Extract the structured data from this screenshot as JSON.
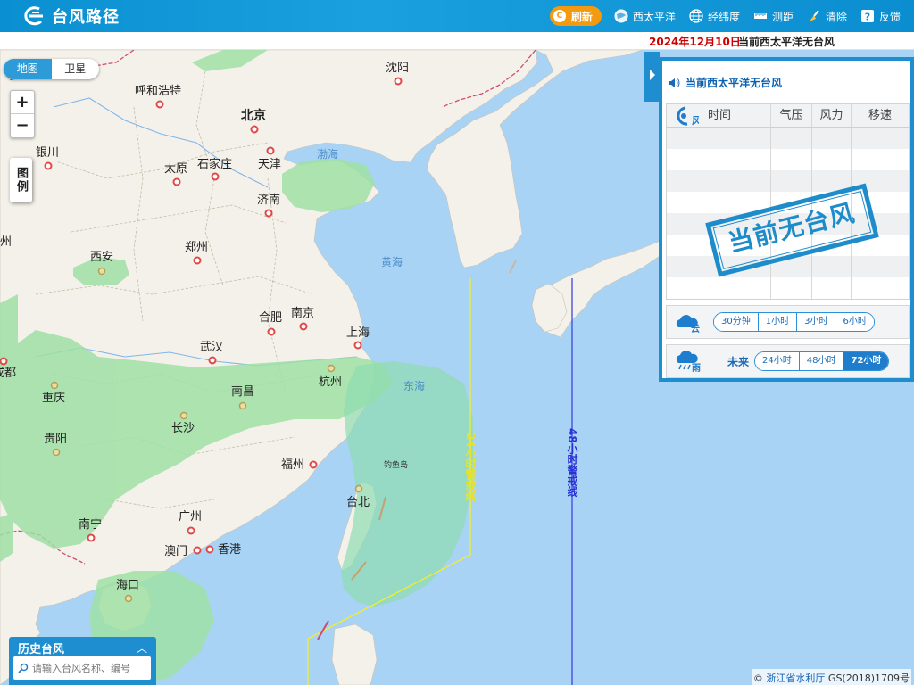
{
  "header": {
    "app_title": "台风路径",
    "tools": {
      "refresh": "刷新",
      "west_pacific": "西太平洋",
      "lat_lon": "经纬度",
      "measure": "测距",
      "clear": "清除",
      "feedback": "反馈"
    },
    "icons": {
      "refresh": "refresh-icon",
      "west_pacific": "globe-icon",
      "lat_lon": "grid-globe-icon",
      "measure": "ruler-icon",
      "clear": "broom-icon",
      "feedback": "help-icon"
    }
  },
  "datebar": {
    "date": "2024年12月10日",
    "message": "当前西太平洋无台风"
  },
  "map": {
    "toggle": {
      "map": "地图",
      "satellite": "卫星",
      "active": "map"
    },
    "zoom_in": "+",
    "zoom_out": "−",
    "legend": "图例",
    "cities": {
      "shenyang": "沈阳",
      "hohhot": "呼和浩特",
      "beijing": "北京",
      "yinchuan": "银川",
      "taiyuan": "太原",
      "shijiazhuang": "石家庄",
      "tianjin": "天津",
      "jinan": "济南",
      "zhengzhou": "郑州",
      "xian": "西安",
      "hefei": "合肥",
      "nanjing": "南京",
      "shanghai": "上海",
      "wuhan": "武汉",
      "hangzhou": "杭州",
      "chengdu": "成都",
      "chongqing": "重庆",
      "nanchang": "南昌",
      "changsha": "长沙",
      "guiyang": "贵阳",
      "fuzhou": "福州",
      "taipei": "台北",
      "nanning": "南宁",
      "guangzhou": "广州",
      "macau": "澳门",
      "hongkong": "香港",
      "haikou": "海口",
      "xining_partial": "州"
    },
    "seas": {
      "bohai": "渤海",
      "yellow_sea": "黄海",
      "east_china_sea": "东海",
      "diaoyu": "钓鱼岛"
    },
    "warning_24": "24小时警戒线",
    "warning_48": "48小时警戒线",
    "colors": {
      "warning_24": "#f2ee2a",
      "warning_48": "#3d47e0",
      "rain_zone": "#86d9a4",
      "land": "#f5f2ea",
      "sea": "#a9d3f5"
    }
  },
  "panel": {
    "title": "当前西太平洋无台风",
    "table_header": {
      "icon_label": "风",
      "time": "时间",
      "pressure": "气压",
      "wind_force": "风力",
      "speed": "移速"
    },
    "stamp": "当前无台风",
    "cloud": {
      "icon_label": "云",
      "options": [
        "30分钟",
        "1小时",
        "3小时",
        "6小时"
      ],
      "active": -1
    },
    "rain": {
      "icon_label": "雨",
      "label": "未来",
      "options": [
        "24小时",
        "48小时",
        "72小时"
      ],
      "active": 2
    }
  },
  "history": {
    "title": "历史台风",
    "caret": "︿",
    "placeholder": "请输入台风名称、编号"
  },
  "footer": {
    "prefix": "©",
    "org": "浙江省水利厅",
    "code": "GS(2018)1709号"
  }
}
